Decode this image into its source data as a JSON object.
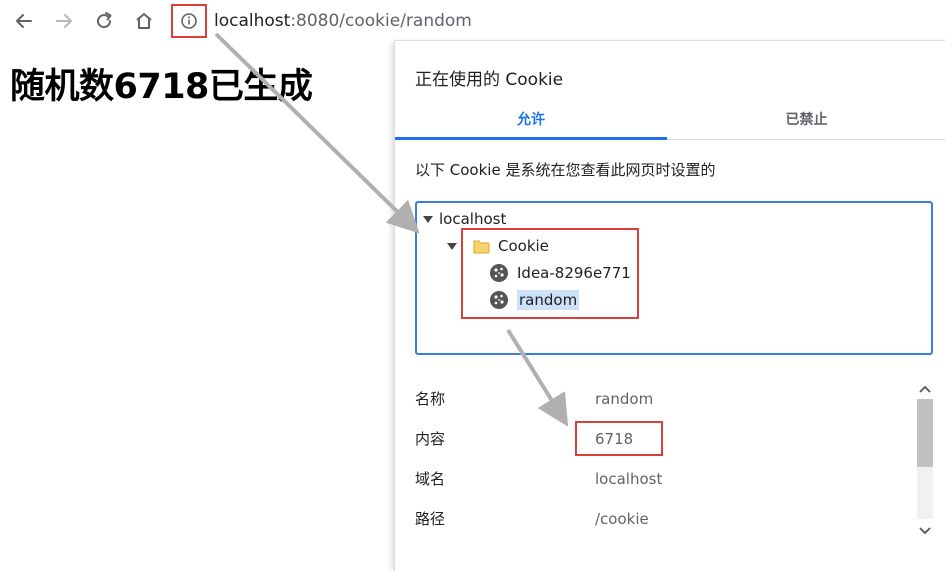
{
  "toolbar": {
    "back_icon": "back-arrow-icon",
    "forward_icon": "forward-arrow-icon",
    "reload_icon": "reload-icon",
    "home_icon": "home-icon",
    "info_icon": "info-icon",
    "url_host": "localhost",
    "url_rest": ":8080/cookie/random"
  },
  "page": {
    "heading": "随机数6718已生成"
  },
  "dialog": {
    "title": "正在使用的 Cookie",
    "tabs": [
      "允许",
      "已禁止"
    ],
    "description": "以下 Cookie 是系统在您查看此网页时设置的",
    "tree": {
      "site": "localhost",
      "folder": "Cookie",
      "cookies": [
        "Idea-8296e771",
        "random"
      ]
    },
    "details": [
      {
        "label": "名称",
        "value": "random"
      },
      {
        "label": "内容",
        "value": "6718"
      },
      {
        "label": "域名",
        "value": "localhost"
      },
      {
        "label": "路径",
        "value": "/cookie"
      }
    ]
  },
  "colors": {
    "accent": "#1a73e8",
    "annotation_red": "#d9403a",
    "arrow_gray": "#b0b0b0",
    "selection": "#cce0f8"
  }
}
